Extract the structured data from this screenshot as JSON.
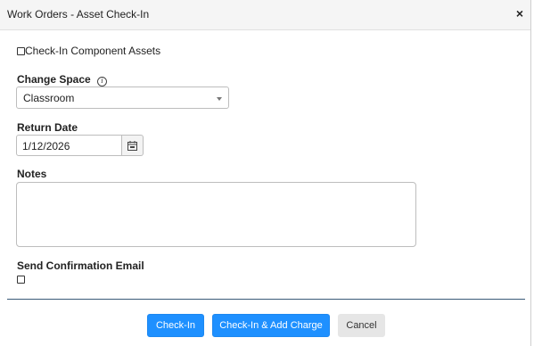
{
  "dialog": {
    "title": "Work Orders - Asset Check-In",
    "close_label": "×"
  },
  "form": {
    "component_assets_label": "Check-In Component Assets",
    "component_assets_checked": false,
    "change_space_label": "Change Space",
    "change_space_value": "Classroom",
    "return_date_label": "Return Date",
    "return_date_value": "1/12/2026",
    "notes_label": "Notes",
    "notes_value": "",
    "send_email_label": "Send Confirmation Email",
    "send_email_checked": false
  },
  "buttons": {
    "checkin": "Check-In",
    "checkin_add_charge": "Check-In & Add Charge",
    "cancel": "Cancel"
  },
  "icons": {
    "info": "info-icon",
    "calendar": "calendar-icon",
    "dropdown": "chevron-down-icon",
    "close": "close-icon"
  },
  "colors": {
    "primary": "#1e90ff",
    "divider": "#3a5a78",
    "title_bar": "#f5f5f5"
  }
}
